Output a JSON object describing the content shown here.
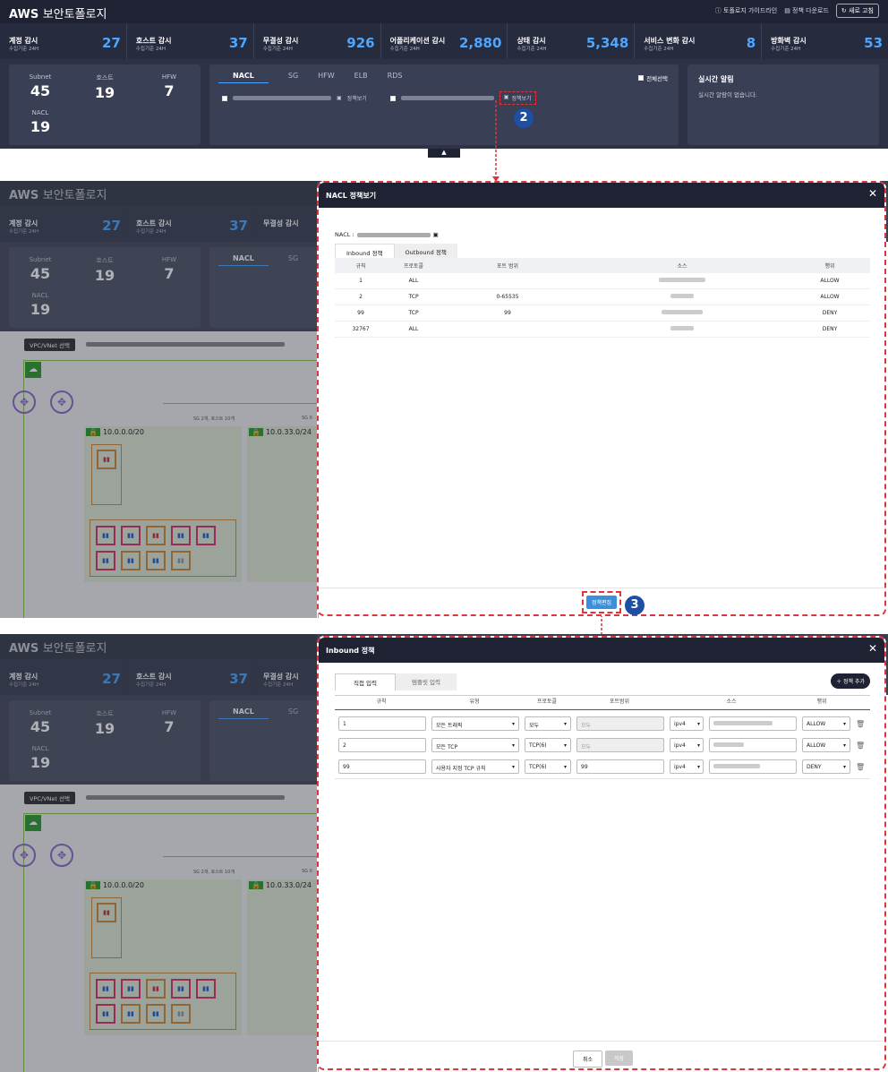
{
  "brand": {
    "aws": "AWS",
    "name": "보안토폴로지"
  },
  "topbar": {
    "guide": "토폴로지 가이드라인",
    "download": "정책 다운로드",
    "refresh": "새로 고침"
  },
  "stats": [
    {
      "title": "계정 감시",
      "sub": "수집기준 24H",
      "value": "27"
    },
    {
      "title": "호스트 감시",
      "sub": "수집기준 24H",
      "value": "37"
    },
    {
      "title": "무결성 감시",
      "sub": "수집기준 24H",
      "value": "926"
    },
    {
      "title": "어플리케이션 감시",
      "sub": "수집기준 24H",
      "value": "2,880"
    },
    {
      "title": "상태 감시",
      "sub": "수집기준 24H",
      "value": "5,348"
    },
    {
      "title": "서비스 변화 감시",
      "sub": "수집기준 24H",
      "value": "8"
    },
    {
      "title": "방화벽 감시",
      "sub": "수집기준 24H",
      "value": "53"
    }
  ],
  "counts": {
    "subnet_label": "Subnet",
    "subnet": "45",
    "host_label": "호스트",
    "host": "19",
    "hfw_label": "HFW",
    "hfw": "7",
    "nacl_label": "NACL",
    "nacl": "19"
  },
  "tabs": [
    "NACL",
    "SG",
    "HFW",
    "ELB",
    "RDS"
  ],
  "select_all": "전체선택",
  "view_policy": "정책보기",
  "alert": {
    "title": "실시간 알림",
    "empty": "실시간 알람이 없습니다."
  },
  "markers": {
    "m2": "2",
    "m3": "3"
  },
  "modal1": {
    "title": "NACL 정책보기",
    "nacl_label": "NACL :",
    "tab_in": "Inbound 정책",
    "tab_out": "Outbound 정책",
    "headers": [
      "규칙",
      "프로토콜",
      "포트 범위",
      "소스",
      "행위"
    ],
    "rows": [
      [
        "1",
        "ALL",
        "",
        "",
        "ALLOW"
      ],
      [
        "2",
        "TCP",
        "0-65535",
        "",
        "ALLOW"
      ],
      [
        "99",
        "TCP",
        "99",
        "",
        "DENY"
      ],
      [
        "32767",
        "ALL",
        "",
        "",
        "DENY"
      ]
    ],
    "edit": "정책편집"
  },
  "bg": {
    "vpc_btn": "VPC/VNet 선택",
    "sg_info": "SG 2개, 호스트 10개",
    "sg_short": "SG 0",
    "subnet_a": "10.0.0.0/20",
    "subnet_b": "10.0.33.0/24"
  },
  "modal2": {
    "title": "Inbound 정책",
    "tab_direct": "직접 입력",
    "tab_template": "템플릿 입력",
    "add": "정책 추가",
    "headers": [
      "규칙",
      "유형",
      "프로토콜",
      "포트범위",
      "소스",
      "행위"
    ],
    "rows": [
      {
        "rule": "1",
        "type": "모든 트래픽",
        "proto": "모두",
        "port": "모두",
        "ipv": "ipv4",
        "action": "ALLOW"
      },
      {
        "rule": "2",
        "type": "모든 TCP",
        "proto": "TCP(6)",
        "port": "모두",
        "ipv": "ipv4",
        "action": "ALLOW"
      },
      {
        "rule": "99",
        "type": "사용자 지정 TCP 규칙",
        "proto": "TCP(6)",
        "port": "99",
        "ipv": "ipv4",
        "action": "DENY"
      }
    ],
    "cancel": "취소",
    "save": "저장"
  }
}
